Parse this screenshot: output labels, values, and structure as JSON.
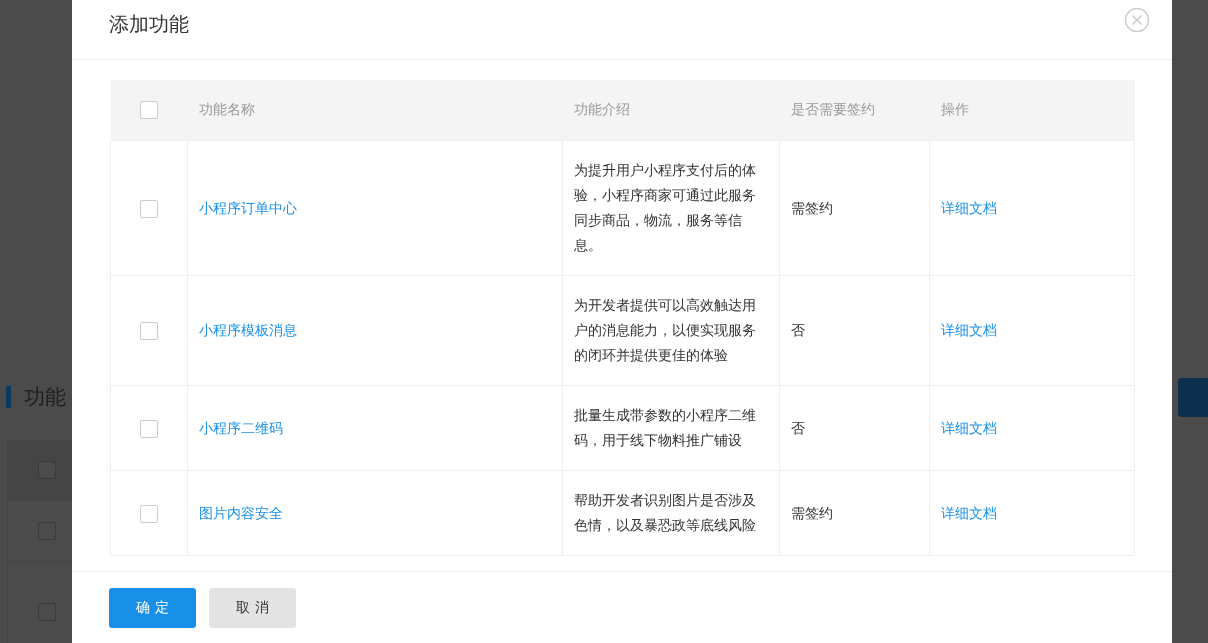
{
  "background": {
    "heading": "功能",
    "table_rows": [
      {
        "checked": false
      },
      {
        "checked": false
      },
      {
        "checked": false
      }
    ]
  },
  "dialog": {
    "title": "添加功能",
    "table": {
      "header_checked": false,
      "columns": [
        "功能名称",
        "功能介绍",
        "是否需要签约",
        "操作"
      ],
      "rows": [
        {
          "checked": false,
          "name": "小程序订单中心",
          "intro": "为提升用户小程序支付后的体验，小程序商家可通过此服务同步商品，物流，服务等信息。",
          "sign": "需签约",
          "action": "详细文档"
        },
        {
          "checked": false,
          "name": "小程序模板消息",
          "intro": "为开发者提供可以高效触达用户的消息能力，以便实现服务的闭环并提供更佳的体验",
          "sign": "否",
          "action": "详细文档"
        },
        {
          "checked": false,
          "name": "小程序二维码",
          "intro": "批量生成带参数的小程序二维码，用于线下物料推广铺设",
          "sign": "否",
          "action": "详细文档"
        },
        {
          "checked": false,
          "name": "图片内容安全",
          "intro": "帮助开发者识别图片是否涉及色情，以及暴恐政等底线风险",
          "sign": "需签约",
          "action": "详细文档"
        }
      ]
    },
    "buttons": [
      {
        "label": "确 定",
        "kind": "primary"
      },
      {
        "label": "取 消",
        "kind": "default"
      }
    ]
  }
}
